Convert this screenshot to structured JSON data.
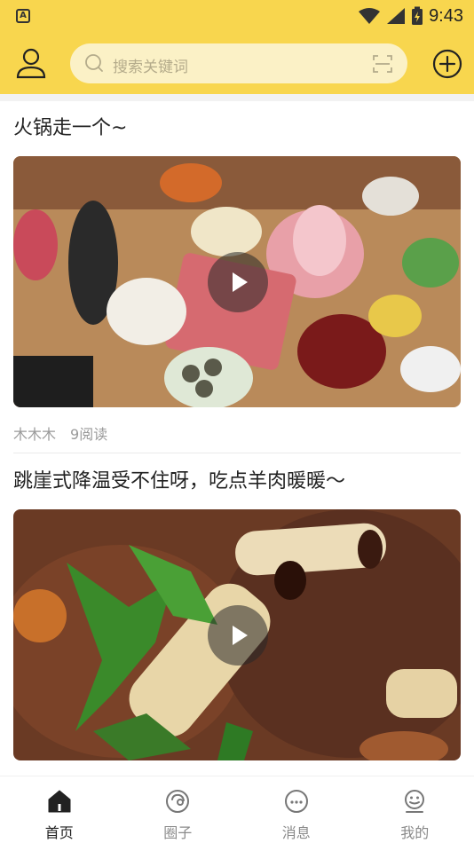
{
  "status_bar": {
    "app_badge": "A",
    "time": "9:43"
  },
  "header": {
    "search_placeholder": "搜索关键词"
  },
  "feed": [
    {
      "title": "火锅走一个~",
      "author": "木木木",
      "reads": "9阅读"
    },
    {
      "title": "跳崖式降温受不住呀，吃点羊肉暖暖～"
    }
  ],
  "tabs": [
    {
      "label": "首页",
      "icon": "home-icon",
      "active": true
    },
    {
      "label": "圈子",
      "icon": "circle-icon",
      "active": false
    },
    {
      "label": "消息",
      "icon": "message-icon",
      "active": false
    },
    {
      "label": "我的",
      "icon": "profile-icon",
      "active": false
    }
  ],
  "colors": {
    "brand_yellow": "#f8d64e",
    "search_bg": "#fbf1c6",
    "active_tab": "#222222",
    "inactive_tab": "#8a8a8a"
  }
}
